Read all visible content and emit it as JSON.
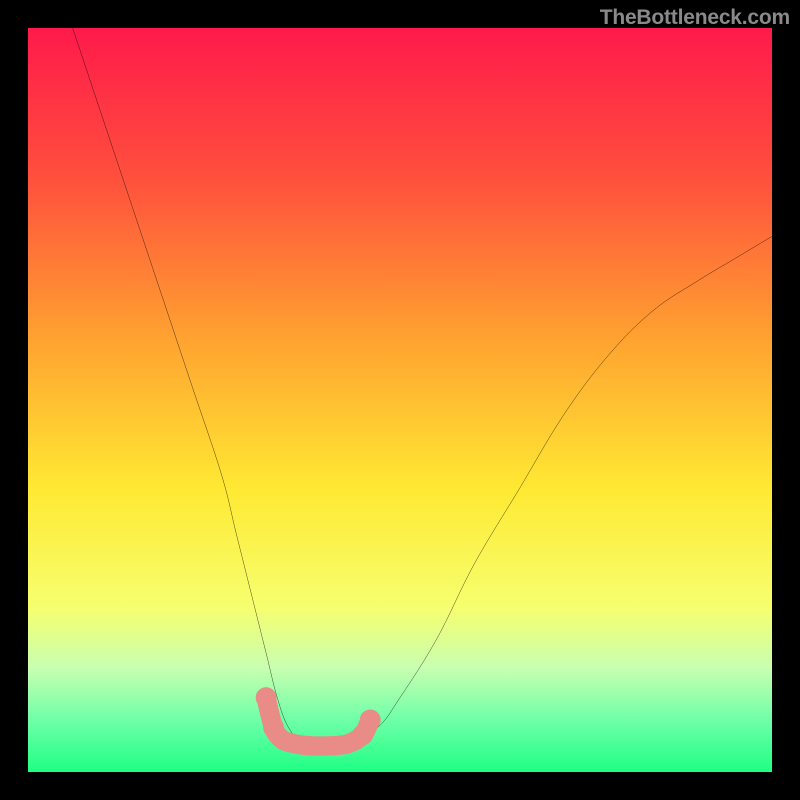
{
  "watermark": "TheBottleneck.com",
  "chart_data": {
    "type": "line",
    "title": "",
    "xlabel": "",
    "ylabel": "",
    "xlim": [
      0,
      100
    ],
    "ylim": [
      0,
      100
    ],
    "grid": false,
    "gradient_background": {
      "stops": [
        {
          "pct": 0,
          "color": "#ff1a4b"
        },
        {
          "pct": 20,
          "color": "#ff4f3d"
        },
        {
          "pct": 42,
          "color": "#ffa330"
        },
        {
          "pct": 62,
          "color": "#ffe933"
        },
        {
          "pct": 78,
          "color": "#f6ff70"
        },
        {
          "pct": 86,
          "color": "#c8ffb0"
        },
        {
          "pct": 93,
          "color": "#6fffa8"
        },
        {
          "pct": 100,
          "color": "#1fff84"
        }
      ]
    },
    "series": [
      {
        "name": "bottleneck-curve",
        "color": "#000000",
        "x": [
          6,
          10,
          14,
          18,
          22,
          26,
          28,
          30,
          32,
          33.5,
          35,
          37,
          40,
          43,
          47,
          50,
          55,
          60,
          66,
          72,
          78,
          84,
          90,
          95,
          100
        ],
        "y": [
          100,
          88,
          76,
          64,
          52,
          40,
          32,
          24,
          16,
          10,
          6,
          4,
          3.5,
          4,
          6,
          10,
          18,
          28,
          38,
          48,
          56,
          62,
          66,
          69,
          72
        ]
      },
      {
        "name": "valley-highlight",
        "color": "#e98b87",
        "x": [
          32,
          33,
          34,
          35,
          37,
          40,
          43,
          45,
          46
        ],
        "y": [
          10,
          6,
          4.5,
          4,
          3.6,
          3.5,
          3.8,
          5,
          7
        ]
      }
    ]
  }
}
